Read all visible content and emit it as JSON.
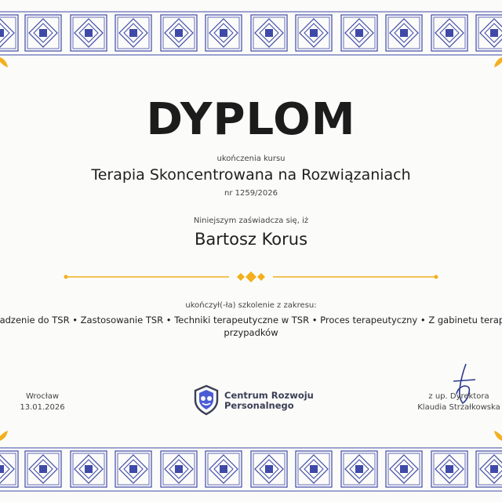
{
  "certificate": {
    "title": "DYPLOM",
    "subtitle": "ukończenia kursu",
    "course_name": "Terapia Skoncentrowana na Rozwiązaniach",
    "number": "nr 1259/2026",
    "intro": "Niniejszym zaświadcza się, iż",
    "recipient": "Bartosz Korus",
    "completed_text": "ukończył(-ła) szkolenie z zakresu:",
    "topics_line1": "Wprowadzenie do TSR • Zastosowanie TSR • Techniki terapeutyczne w TSR • Proces terapeutyczny • Z gabinetu terapeuty: analiza",
    "topics_line2": "przypadków"
  },
  "footer": {
    "city": "Wrocław",
    "date": "13.01.2026",
    "logo_line1": "Centrum Rozwoju",
    "logo_line2": "Personalnego",
    "signer_role": "z up. Dyrektora",
    "signer_name": "Klaudia Strzałkowska"
  },
  "colors": {
    "border_blue": "#3f4aa8",
    "accent_gold": "#f2b01e",
    "logo_dark": "#3b3f55"
  },
  "icons": {
    "logo": "brand-shield-icon",
    "divider": "diamond-divider-icon",
    "corner": "gold-leaf-ornament-icon"
  }
}
